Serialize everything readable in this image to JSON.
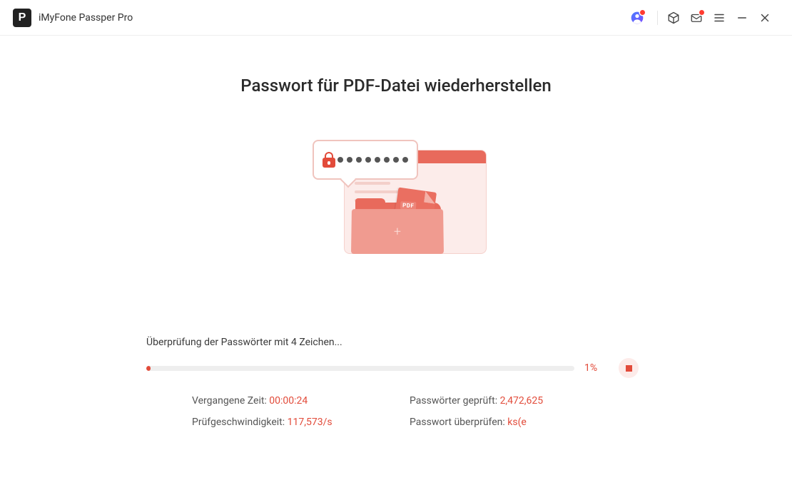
{
  "header": {
    "app_title": "iMyFone Passper Pro"
  },
  "page": {
    "title": "Passwort für PDF-Datei wiederherstellen"
  },
  "illustration": {
    "pdf_badge": "PDF"
  },
  "progress": {
    "status_text": "Überprüfung der Passwörter mit 4 Zeichen...",
    "percent_value": 1,
    "percent_text": "1%"
  },
  "stats": {
    "elapsed_label": "Vergangene Zeit: ",
    "elapsed_value": "00:00:24",
    "speed_label": "Prüfgeschwindigkeit: ",
    "speed_value": "117,573/s",
    "checked_label": "Passwörter geprüft: ",
    "checked_value": "2,472,625",
    "current_label": "Passwort überprüfen: ",
    "current_value": "ks(e"
  }
}
